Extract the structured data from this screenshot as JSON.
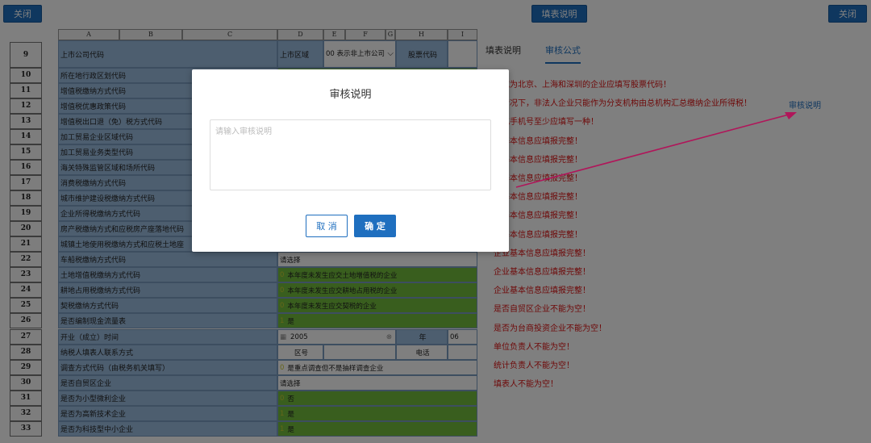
{
  "topbar": {
    "close_left": "关闭",
    "instructions": "填表说明",
    "close_right": "关闭"
  },
  "sheet": {
    "col_headers": [
      "A",
      "B",
      "C",
      "D",
      "E",
      "F",
      "G",
      "H",
      "I"
    ],
    "row9": {
      "num": "9",
      "label": "上市公司代码",
      "region_label": "上市区域",
      "region_value": "00 表示非上市公司",
      "stock_label": "股票代码"
    },
    "rows": [
      {
        "num": "10",
        "label": "所在地行政区划代码",
        "value": "",
        "code": "",
        "style": "green"
      },
      {
        "num": "11",
        "label": "增值税缴纳方式代码",
        "value": "",
        "code": "",
        "style": "green"
      },
      {
        "num": "12",
        "label": "增值税优惠政策代码",
        "value": "",
        "code": "",
        "style": "green"
      },
      {
        "num": "13",
        "label": "增值税出口退（免）税方式代码",
        "value": "",
        "code": "",
        "style": "green"
      },
      {
        "num": "14",
        "label": "加工贸易企业区域代码",
        "value": "",
        "code": "",
        "style": "green"
      },
      {
        "num": "15",
        "label": "加工贸易业务类型代码",
        "value": "",
        "code": "",
        "style": "green"
      },
      {
        "num": "16",
        "label": "海关特殊监管区域和场所代码",
        "value": "",
        "code": "",
        "style": "green"
      },
      {
        "num": "17",
        "label": "消费税缴纳方式代码",
        "value": "",
        "code": "",
        "style": "green"
      },
      {
        "num": "18",
        "label": "城市维护建设税缴纳方式代码",
        "value": "",
        "code": "",
        "style": "green"
      },
      {
        "num": "19",
        "label": "企业所得税缴纳方式代码",
        "value": "",
        "code": "",
        "style": "green"
      },
      {
        "num": "20",
        "label": "房产税缴纳方式和应税房产座落地代码",
        "value": "",
        "code": "",
        "style": "green"
      },
      {
        "num": "21",
        "label": "城镇土地使用税缴纳方式和应税土地座",
        "value": "",
        "code": "",
        "style": "green"
      },
      {
        "num": "22",
        "label": "车船税缴纳方式代码",
        "value": "请选择",
        "code": "",
        "style": "white"
      },
      {
        "num": "23",
        "label": "土地增值税缴纳方式代码",
        "value": "本年度未发生应交土地增值税的企业",
        "code": "0",
        "style": "green"
      },
      {
        "num": "24",
        "label": "耕地占用税缴纳方式代码",
        "value": "本年度未发生应交耕地占用税的企业",
        "code": "0",
        "style": "green"
      },
      {
        "num": "25",
        "label": "契税缴纳方式代码",
        "value": "本年度未发生应交契税的企业",
        "code": "0",
        "style": "green"
      },
      {
        "num": "26",
        "label": "是否编制现金流量表",
        "value": "是",
        "code": "1",
        "style": "green"
      }
    ],
    "row27": {
      "num": "27",
      "label": "开业（成立）时间",
      "year_value": "2005",
      "year_label": "年",
      "month_value": "06"
    },
    "row28": {
      "num": "28",
      "label": "纳税人填表人联系方式",
      "area_label": "区号",
      "phone_label": "电话"
    },
    "rows2": [
      {
        "num": "29",
        "label": "调查方式代码（由税务机关填写）",
        "value": "是重点调查但不是抽样调查企业",
        "code": "0",
        "style": "white"
      },
      {
        "num": "30",
        "label": "是否自贸区企业",
        "value": "请选择",
        "code": "",
        "style": "white"
      },
      {
        "num": "31",
        "label": "是否为小型微利企业",
        "value": "否",
        "code": "0",
        "style": "green"
      },
      {
        "num": "32",
        "label": "是否为高新技术企业",
        "value": "是",
        "code": "1",
        "style": "green"
      },
      {
        "num": "33",
        "label": "是否为科技型中小企业",
        "value": "是",
        "code": "1",
        "style": "green"
      }
    ]
  },
  "right_panel": {
    "tabs": [
      "填表说明",
      "审核公式"
    ],
    "active_tab": "审核公式",
    "audit_link": "审核说明",
    "messages": [
      "区域为北京、上海和深圳的企业应填写股票代码！",
      "般情况下，非法人企业只能作为分支机构由总机构汇总缴纳企业所得税！",
      "话或手机号至少应填写一种！",
      "业基本信息应填报完整！",
      "业基本信息应填报完整！",
      "业基本信息应填报完整！",
      "业基本信息应填报完整！",
      "业基本信息应填报完整！",
      "业基本信息应填报完整！",
      "企业基本信息应填报完整！",
      "企业基本信息应填报完整！",
      "企业基本信息应填报完整！",
      "是否自贸区企业不能为空！",
      "是否为台商投资企业不能为空！",
      "单位负责人不能为空！",
      "统计负责人不能为空！",
      "填表人不能为空！"
    ]
  },
  "modal": {
    "title": "审核说明",
    "placeholder": "请输入审核说明",
    "cancel": "取 消",
    "ok": "确 定"
  },
  "colors": {
    "primary": "#1f6fbf",
    "label_bg": "#9bbcdf",
    "value_green": "#72bd3c",
    "error_red": "#dd1111"
  }
}
